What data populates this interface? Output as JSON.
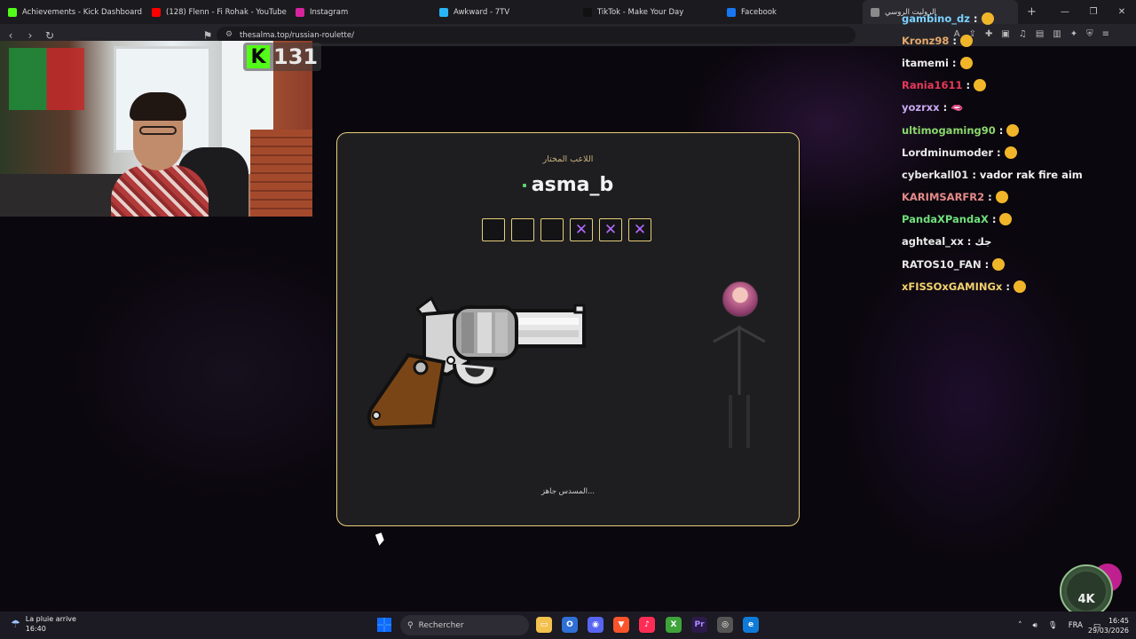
{
  "browser": {
    "tabs": [
      {
        "label": "Achievements - Kick Dashboard",
        "icon": "kick-icon",
        "color": "#53fc18"
      },
      {
        "label": "(128) Flenn - Fi Rohak - YouTube",
        "icon": "youtube-icon",
        "color": "#ff0000"
      },
      {
        "label": "Instagram",
        "icon": "instagram-icon",
        "color": "#d6249f"
      },
      {
        "label": "Awkward - 7TV",
        "icon": "7tv-icon",
        "color": "#29b6f6"
      },
      {
        "label": "TikTok - Make Your Day",
        "icon": "tiktok-icon",
        "color": "#111111"
      },
      {
        "label": "Facebook",
        "icon": "facebook-icon",
        "color": "#1877f2"
      },
      {
        "label": "الروليت الروسي",
        "icon": "audio-icon",
        "color": "#8a8a8a"
      }
    ],
    "url": "thesalma.top/russian-roulette/"
  },
  "webcam": {
    "kick_viewer_count": "131"
  },
  "game": {
    "caption": "اللاعب المختار",
    "player_name": "asma_b",
    "chambers": [
      {
        "state": "empty",
        "mark": ""
      },
      {
        "state": "empty",
        "mark": ""
      },
      {
        "state": "empty",
        "mark": ""
      },
      {
        "state": "used",
        "mark": "✕"
      },
      {
        "state": "used",
        "mark": "✕"
      },
      {
        "state": "used",
        "mark": "✕"
      }
    ],
    "status": "المسدس جاهز...",
    "accent_color": "#e8cf7a",
    "mark_color": "#b46bff"
  },
  "chat": [
    {
      "user": "gambino_dz",
      "color": "#7ad1ff",
      "message": ""
    },
    {
      "user": "Kronz98",
      "color": "#e4a86b",
      "message": ""
    },
    {
      "user": "itamemi",
      "color": "#e9e9e9",
      "message": ""
    },
    {
      "user": "Rania1611",
      "color": "#e63a5a",
      "message": ""
    },
    {
      "user": "yozrxx",
      "color": "#c8a9f0",
      "message": "🫦"
    },
    {
      "user": "ultimogaming90",
      "color": "#8bd86c",
      "message": ""
    },
    {
      "user": "Lordminumoder",
      "color": "#e9e9e9",
      "message": ""
    },
    {
      "user": "cyberkall01",
      "color": "#e9e9e9",
      "message": "vador rak fire aim"
    },
    {
      "user": "KARIMSARFR2",
      "color": "#e58a8a",
      "message": ""
    },
    {
      "user": "PandaXPandaX",
      "color": "#6fe07c",
      "message": ""
    },
    {
      "user": "aghteal_xx",
      "color": "#e9e9e9",
      "message": "جك"
    },
    {
      "user": "RATOS10_FAN",
      "color": "#e9e9e9",
      "message": ""
    },
    {
      "user": "xFISSOxGAMINGx",
      "color": "#f3d36b",
      "message": ""
    }
  ],
  "overlay": {
    "logo_text": "4K"
  },
  "taskbar": {
    "weather_title": "La pluie arrive",
    "weather_time": "16:40",
    "search_placeholder": "Rechercher",
    "language": "FRA",
    "clock_time": "16:45",
    "clock_date": "29/03/2026"
  }
}
